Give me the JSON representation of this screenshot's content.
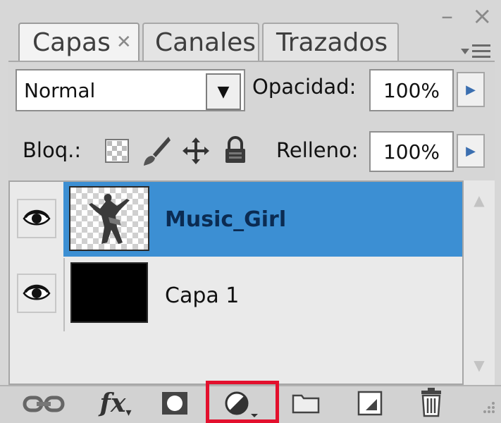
{
  "panel": {
    "tabs": [
      {
        "label": "Capas",
        "active": true,
        "closable": true
      },
      {
        "label": "Canales",
        "active": false
      },
      {
        "label": "Trazados",
        "active": false
      }
    ],
    "window_controls": {
      "minimize_icon": "minimize-icon",
      "close_icon": "close-icon"
    },
    "menu_icon": "panel-menu-icon"
  },
  "blend": {
    "mode": "Normal",
    "opacity_label": "Opacidad:",
    "opacity_value": "100%"
  },
  "lock": {
    "label": "Bloq.:",
    "fill_label": "Relleno:",
    "fill_value": "100%",
    "icons": [
      "lock-transparent-icon",
      "lock-image-icon",
      "lock-position-icon",
      "lock-all-icon"
    ]
  },
  "layers": [
    {
      "name": "Music_Girl",
      "selected": true,
      "visible": true,
      "thumbnail": "girl-silhouette"
    },
    {
      "name": "Capa 1",
      "selected": false,
      "visible": true,
      "thumbnail": "black-fill"
    }
  ],
  "toolbar": {
    "icons": [
      "link-layers-icon",
      "layer-style-icon",
      "add-mask-icon",
      "adjustment-layer-icon",
      "new-group-icon",
      "new-layer-icon",
      "delete-layer-icon"
    ],
    "fx_text": "fx",
    "highlighted": "adjustment-layer-icon"
  },
  "colors": {
    "selection": "#3c8fd3",
    "highlight": "#e3102d",
    "panel_bg": "#d7d7d7"
  }
}
